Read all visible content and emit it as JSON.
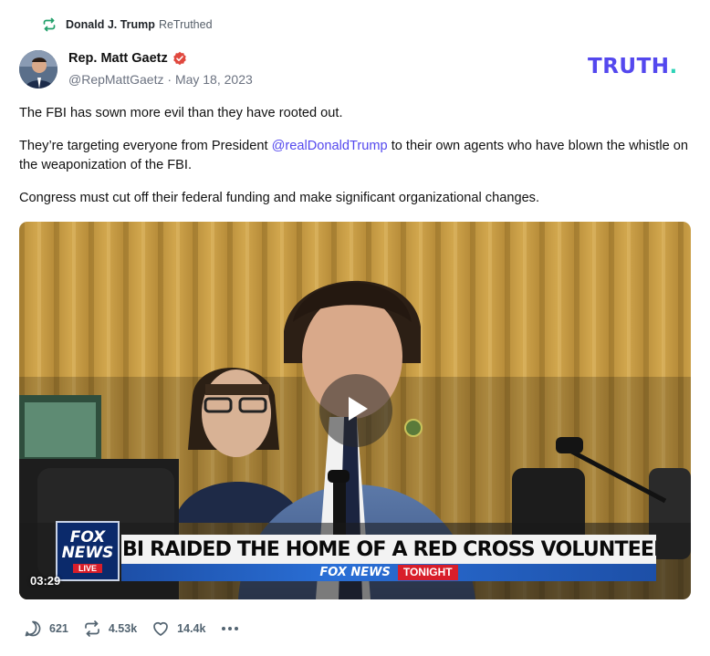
{
  "retruth": {
    "user": "Donald J. Trump",
    "action": "ReTruthed",
    "icon": "retruth-icon",
    "icon_color": "#22a06b"
  },
  "post": {
    "author_name": "Rep. Matt Gaetz",
    "verified_icon": "verified-badge-icon",
    "verified_color": "#e0483e",
    "handle": "@RepMattGaetz",
    "separator": "·",
    "date": "May 18, 2023",
    "paragraphs": [
      {
        "text": "The FBI has sown more evil than they have rooted out."
      },
      {
        "before": "They’re targeting everyone from President ",
        "mention": "@realDonaldTrump",
        "after": " to their own agents who have blown the whistle on the weaponization of the FBI."
      },
      {
        "text": "Congress must cut off their federal funding and make significant organizational changes."
      }
    ]
  },
  "brand": {
    "logo_text": "TRUTH",
    "logo_dot": ".",
    "logo_color": "#5448ee",
    "dot_color": "#2ed3b7"
  },
  "video": {
    "duration": "03:29",
    "play_icon": "play-icon",
    "network_logo_line1": "FOX",
    "network_logo_line2": "NEWS",
    "network_live": "LIVE",
    "chyron_headline": "FBI RAIDED THE HOME OF A RED CROSS VOLUNTEER",
    "chyron_network": "FOX NEWS",
    "chyron_show": "TONIGHT"
  },
  "actions": {
    "replies": {
      "icon": "reply-icon",
      "count": "621"
    },
    "retruths": {
      "icon": "retruth-icon",
      "count": "4.53k"
    },
    "likes": {
      "icon": "heart-icon",
      "count": "14.4k"
    },
    "more": {
      "icon": "more-options-icon"
    }
  }
}
